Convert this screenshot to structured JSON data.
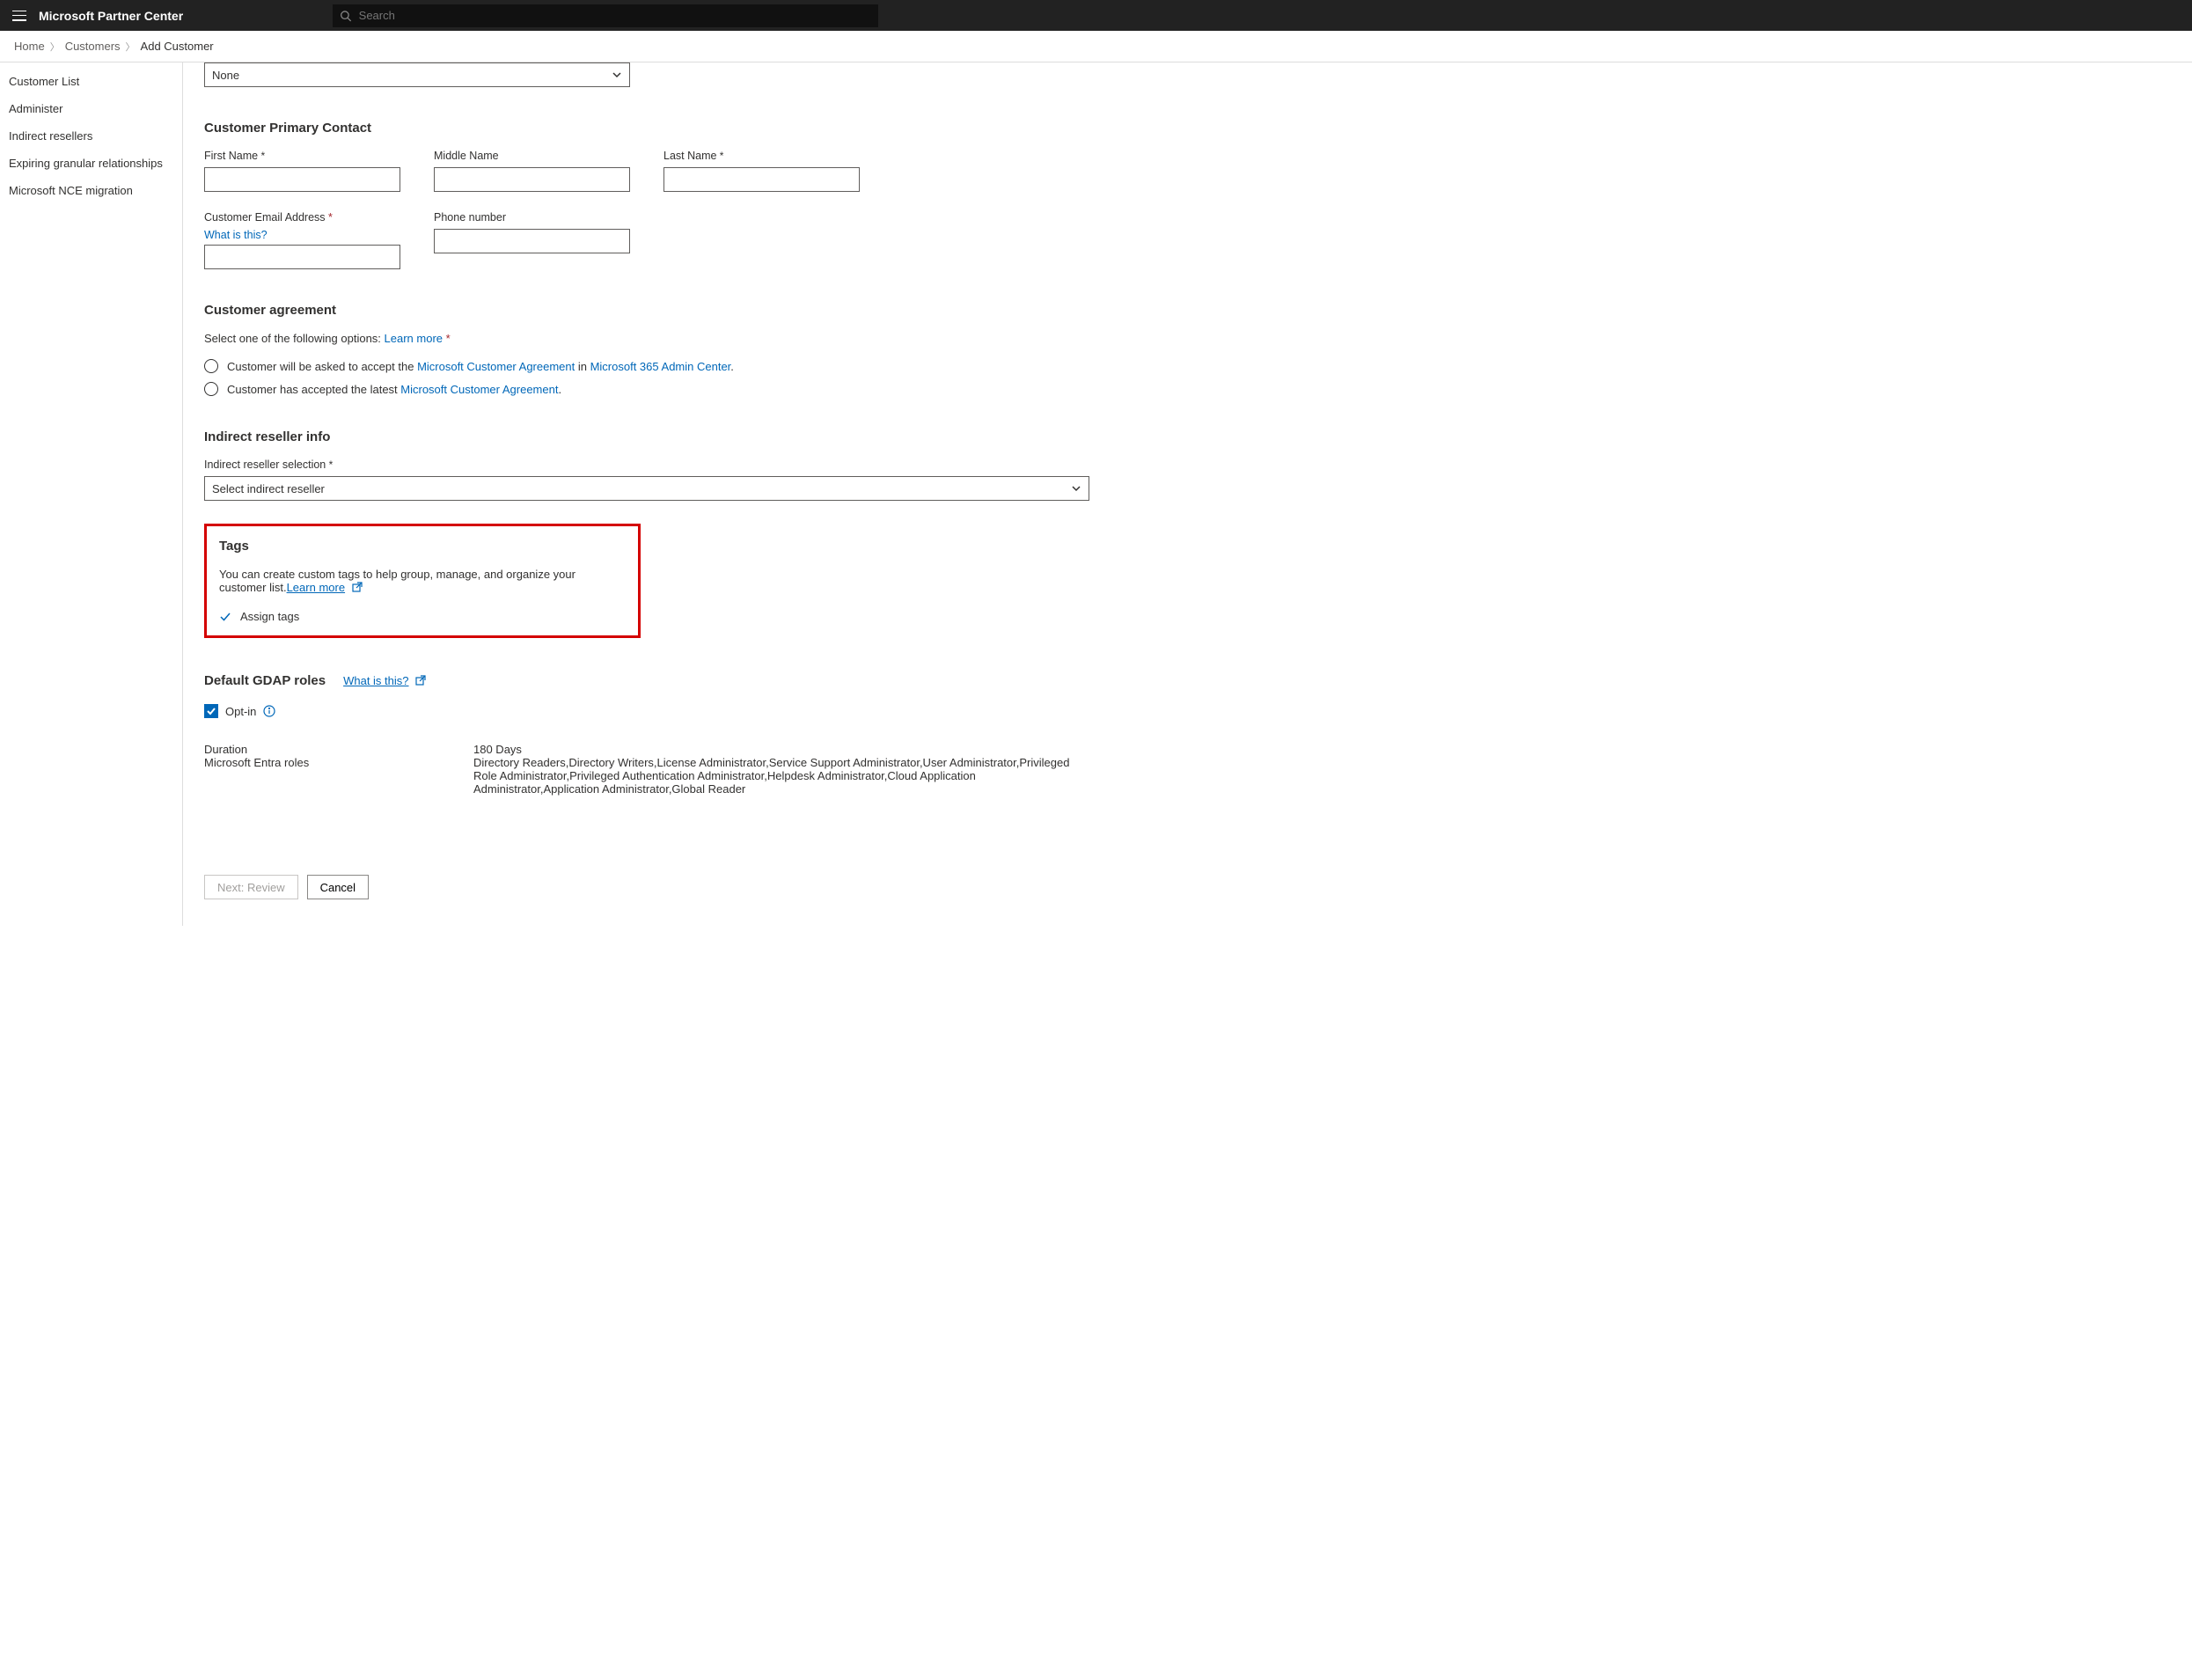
{
  "header": {
    "app_title": "Microsoft Partner Center",
    "search_placeholder": "Search"
  },
  "breadcrumbs": {
    "items": [
      "Home",
      "Customers"
    ],
    "current": "Add Customer"
  },
  "sidebar": {
    "items": [
      {
        "label": "Customer List"
      },
      {
        "label": "Administer"
      },
      {
        "label": "Indirect resellers"
      },
      {
        "label": "Expiring granular relationships"
      },
      {
        "label": "Microsoft NCE migration"
      }
    ]
  },
  "top_select": {
    "selected": "None"
  },
  "primary_contact": {
    "heading": "Customer Primary Contact",
    "first_name_label": "First Name",
    "middle_name_label": "Middle Name",
    "last_name_label": "Last Name",
    "email_label": "Customer Email Address",
    "email_help_link": "What is this?",
    "phone_label": "Phone number"
  },
  "agreement": {
    "heading": "Customer agreement",
    "intro_text": "Select one of the following options: ",
    "learn_more": "Learn more",
    "opt1_prefix": "Customer will be asked to accept the ",
    "opt1_link1": "Microsoft Customer Agreement",
    "opt1_mid": " in ",
    "opt1_link2": "Microsoft 365 Admin Center",
    "opt1_suffix": ".",
    "opt2_prefix": "Customer has accepted the latest ",
    "opt2_link": "Microsoft Customer Agreement",
    "opt2_suffix": "."
  },
  "reseller": {
    "heading": "Indirect reseller info",
    "label": "Indirect reseller selection",
    "placeholder": "Select indirect reseller"
  },
  "tags": {
    "heading": "Tags",
    "desc": "You can create custom tags to help group, manage, and organize your customer list.",
    "learn_more": "Learn  more",
    "assign": "Assign tags"
  },
  "gdap": {
    "heading": "Default GDAP roles",
    "what_is_this": "What is this?",
    "optin_label": "Opt-in",
    "duration_label": "Duration",
    "duration_value": "180 Days",
    "roles_label": "Microsoft Entra roles",
    "roles_value": "Directory Readers,Directory Writers,License Administrator,Service Support Administrator,User Administrator,Privileged Role Administrator,Privileged Authentication Administrator,Helpdesk Administrator,Cloud Application Administrator,Application Administrator,Global Reader"
  },
  "footer": {
    "next": "Next: Review",
    "cancel": "Cancel"
  }
}
